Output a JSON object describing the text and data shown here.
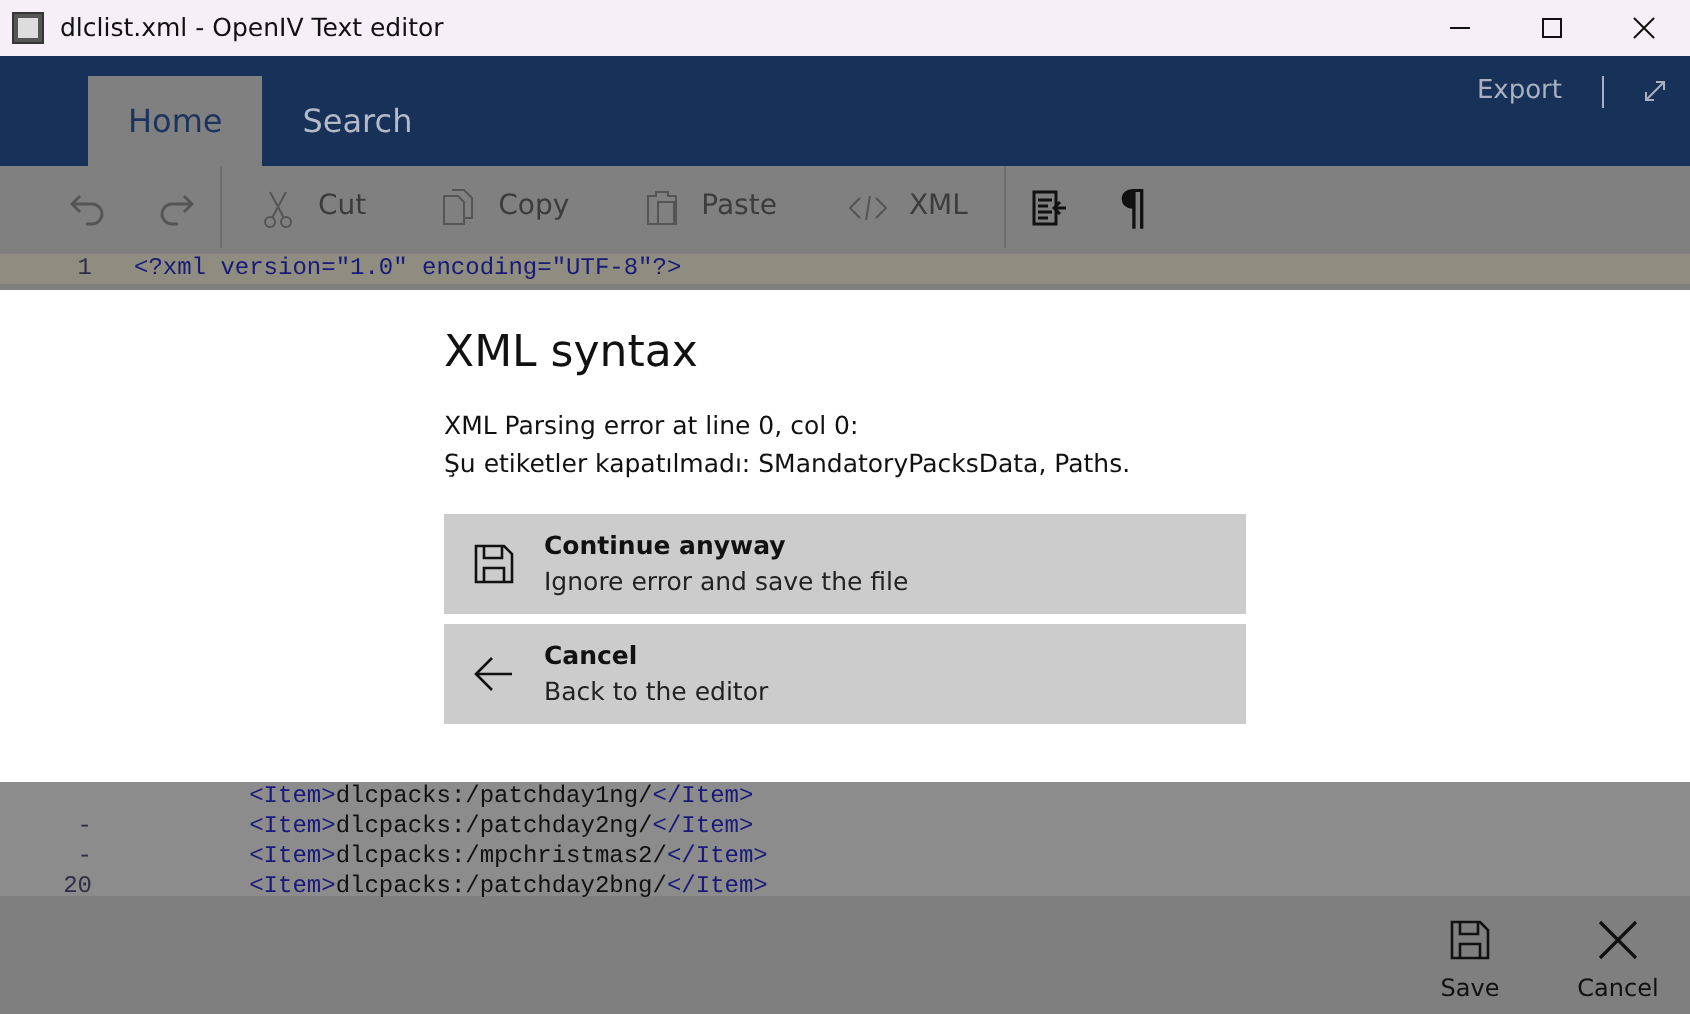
{
  "window": {
    "title": "dlclist.xml - OpenIV Text editor"
  },
  "header": {
    "tabs": [
      {
        "label": "Home",
        "selected": true
      },
      {
        "label": "Search",
        "selected": false
      }
    ],
    "actions": [
      {
        "label": "Export"
      }
    ]
  },
  "toolbar": {
    "items": [
      {
        "kind": "undo",
        "disabled": true
      },
      {
        "kind": "redo",
        "disabled": true
      },
      {
        "kind": "cut",
        "label": "Cut",
        "disabled": true
      },
      {
        "kind": "copy",
        "label": "Copy",
        "disabled": true
      },
      {
        "kind": "paste",
        "label": "Paste",
        "disabled": true
      },
      {
        "kind": "xml",
        "label": "XML",
        "disabled": true
      },
      {
        "kind": "wrap",
        "disabled": false
      },
      {
        "kind": "glyph",
        "label": "¶",
        "disabled": false
      }
    ]
  },
  "editor": {
    "top_lines": [
      {
        "number": "1",
        "text": "<?xml version=\"1.0\" encoding=\"UTF-8\"?>",
        "current": true
      }
    ],
    "bottom_lines": [
      {
        "text": "        <Item>dlcpacks:/patchday1ng/</Item>",
        "current": false
      },
      {
        "number": "-",
        "text": "        <Item>dlcpacks:/patchday2ng/</Item>",
        "current": false
      },
      {
        "number": "-",
        "text": "        <Item>dlcpacks:/mpchristmas2/</Item>",
        "current": false
      },
      {
        "number": "20",
        "text": "        <Item>dlcpacks:/patchday2bng/</Item>",
        "current": false
      }
    ]
  },
  "dialog": {
    "title": "XML syntax",
    "message": [
      "XML Parsing error at line 0, col 0:",
      "Şu etiketler kapatılmadı: SMandatoryPacksData, Paths."
    ],
    "options": [
      {
        "title": "Continue anyway",
        "subtitle": "Ignore error and save the file"
      },
      {
        "title": "Cancel",
        "subtitle": "Back to the editor"
      }
    ]
  },
  "bottom_bar": {
    "buttons": [
      {
        "label": "Save"
      },
      {
        "label": "Cancel"
      }
    ]
  }
}
